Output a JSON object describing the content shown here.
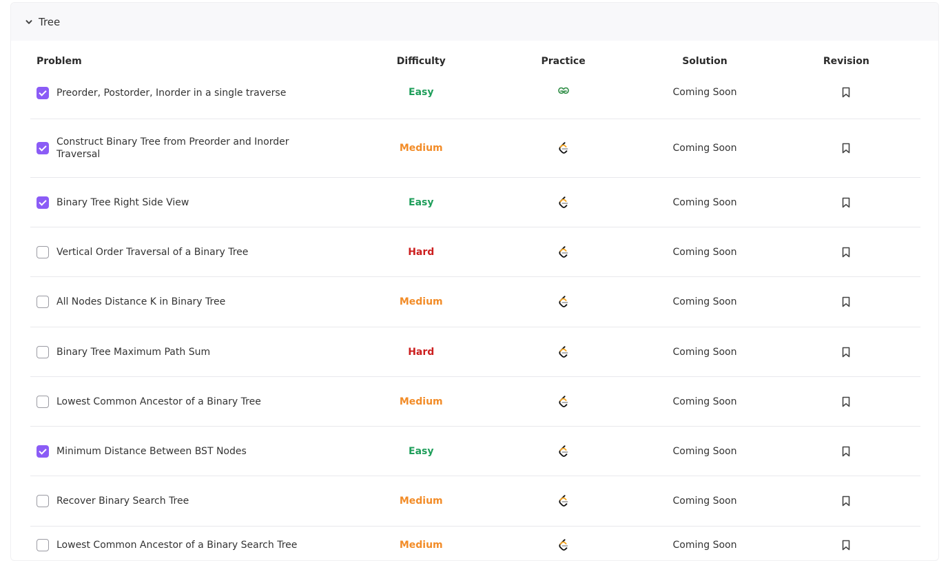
{
  "section": {
    "title": "Tree"
  },
  "columns": {
    "problem": "Problem",
    "difficulty": "Difficulty",
    "practice": "Practice",
    "solution": "Solution",
    "revision": "Revision"
  },
  "rows": [
    {
      "title": "Preorder, Postorder, Inorder in a single traverse",
      "difficulty": "Easy",
      "level": "easy",
      "checked": true,
      "practice_icon": "geeksforgeeks-icon",
      "solution": "Coming Soon"
    },
    {
      "title": "Construct Binary Tree from Preorder and Inorder Traversal",
      "difficulty": "Medium",
      "level": "medium",
      "checked": true,
      "practice_icon": "leetcode-icon",
      "solution": "Coming Soon"
    },
    {
      "title": "Binary Tree Right Side View",
      "difficulty": "Easy",
      "level": "easy",
      "checked": true,
      "practice_icon": "leetcode-icon",
      "solution": "Coming Soon"
    },
    {
      "title": "Vertical Order Traversal of a Binary Tree",
      "difficulty": "Hard",
      "level": "hard",
      "checked": false,
      "practice_icon": "leetcode-icon",
      "solution": "Coming Soon"
    },
    {
      "title": "All Nodes Distance K in Binary Tree",
      "difficulty": "Medium",
      "level": "medium",
      "checked": false,
      "practice_icon": "leetcode-icon",
      "solution": "Coming Soon"
    },
    {
      "title": "Binary Tree Maximum Path Sum",
      "difficulty": "Hard",
      "level": "hard",
      "checked": false,
      "practice_icon": "leetcode-icon",
      "solution": "Coming Soon"
    },
    {
      "title": "Lowest Common Ancestor of a Binary Tree",
      "difficulty": "Medium",
      "level": "medium",
      "checked": false,
      "practice_icon": "leetcode-icon",
      "solution": "Coming Soon"
    },
    {
      "title": "Minimum Distance Between BST Nodes",
      "difficulty": "Easy",
      "level": "easy",
      "checked": true,
      "practice_icon": "leetcode-icon",
      "solution": "Coming Soon"
    },
    {
      "title": "Recover Binary Search Tree",
      "difficulty": "Medium",
      "level": "medium",
      "checked": false,
      "practice_icon": "leetcode-icon",
      "solution": "Coming Soon"
    },
    {
      "title": "Lowest Common Ancestor of a Binary Search Tree",
      "difficulty": "Medium",
      "level": "medium",
      "checked": false,
      "practice_icon": "leetcode-icon",
      "solution": "Coming Soon"
    }
  ],
  "colors": {
    "accent": "#8b5cf6",
    "easy": "#1e9e5a",
    "medium": "#f28c28",
    "hard": "#cc1f1f"
  }
}
